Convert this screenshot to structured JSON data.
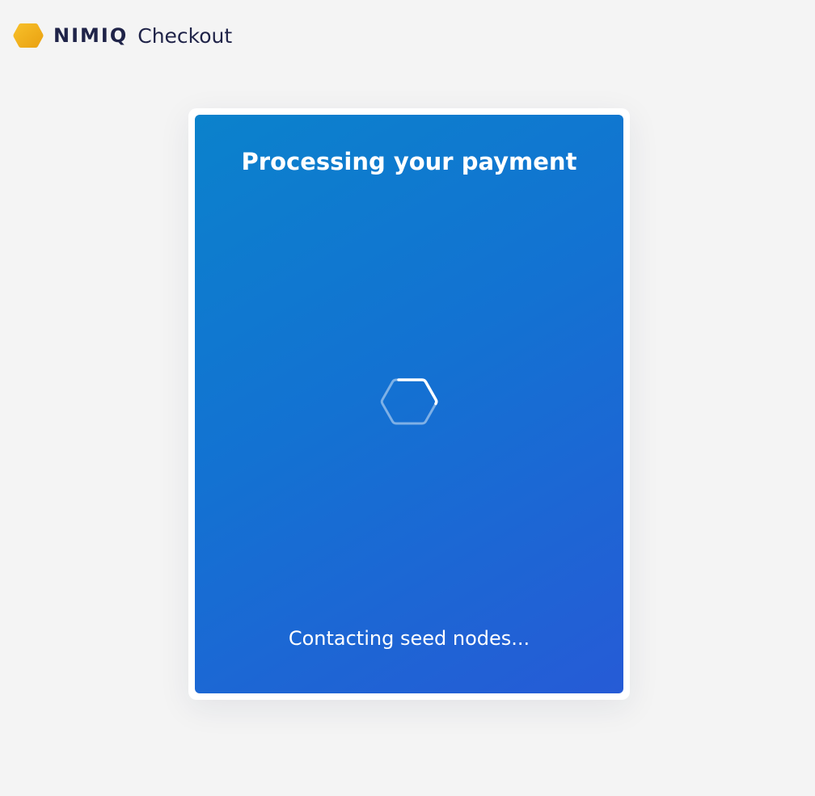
{
  "header": {
    "brand_name": "NIMIQ",
    "product_name": "Checkout",
    "logo_icon": "nimiq-hexagon-icon",
    "logo_color": "#e9a613"
  },
  "card": {
    "title": "Processing your payment",
    "status": "Contacting seed nodes...",
    "spinner_icon": "hexagon-loading-spinner-icon",
    "gradient_start": "#0b82cc",
    "gradient_end": "#265bd6"
  },
  "colors": {
    "page_background": "#f4f4f4",
    "text_dark": "#1f2348",
    "text_light": "#ffffff"
  }
}
